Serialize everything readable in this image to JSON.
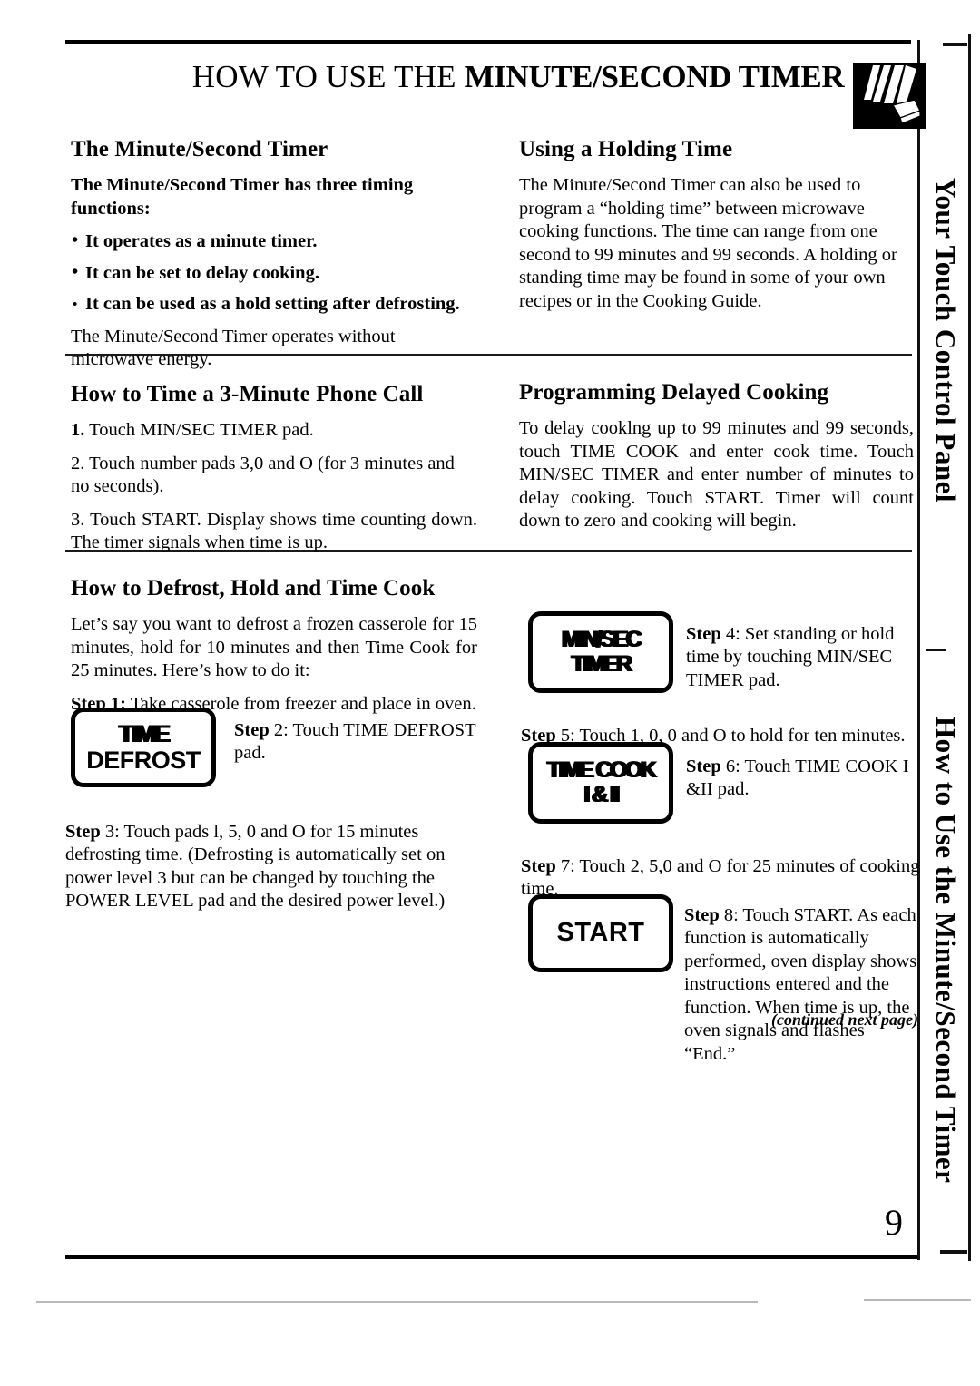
{
  "page": {
    "number": "9",
    "title_light": "HOW TO USE THE ",
    "title_bold": "MINUTE/SECOND TIMER",
    "header_icon": "hand-pressing-pad-icon",
    "continued_note": "(continued next page)"
  },
  "side_tabs": {
    "top": "Your Touch Control Panel",
    "bottom": "How to Use the Minute/Second Timer"
  },
  "sections": {
    "timer": {
      "heading": "The Minute/Second Timer",
      "intro": "The Minute/Second Timer has three timing functions:",
      "bullets": [
        "It operates as a minute timer.",
        "It can be set to delay cooking.",
        "It can be used as a hold setting after defrosting."
      ],
      "closing": "The Minute/Second Timer operates without microwave energy."
    },
    "holding": {
      "heading": "Using a Holding Time",
      "body": "The Minute/Second Timer can also be used to program a “holding time” between microwave cooking functions. The time can range from one second to 99 minutes and 99 seconds. A holding or standing time may be found in some of your own recipes or in the Cooking Guide."
    },
    "phone_call": {
      "heading": "How to Time a 3-Minute Phone Call",
      "steps": [
        {
          "num": "1.",
          "text": " Touch MIN/SEC TIMER pad."
        },
        {
          "num": "2.",
          "text": " Touch number pads 3,0 and O (for 3 minutes and no seconds)."
        },
        {
          "num": "3.",
          "text": " Touch START. Display shows time counting down. The timer signals when time is up."
        }
      ]
    },
    "delayed_cooking": {
      "heading": "Programming Delayed Cooking",
      "body": "To delay cooklng up to 99 minutes and 99 seconds, touch TIME COOK and enter cook time. Touch MIN/SEC TIMER and enter number of minutes to delay cooking. Touch START. Timer will count down to zero and cooking will begin."
    },
    "defrost_hold_cook": {
      "heading": "How to Defrost, Hold and Time Cook",
      "intro": "Let’s say you want to defrost a frozen casserole for 15 minutes, hold for 10 minutes and then Time Cook for 25 minutes. Here’s how to do it:",
      "steps": [
        {
          "num": "Step 1:",
          "text": " Take casserole from freezer and place in oven."
        },
        {
          "num": "Step",
          "text": " 2: Touch TIME DEFROST pad."
        },
        {
          "num": "Step",
          "text": " 3: Touch pads l, 5, 0 and O for 15 minutes defrosting time. (Defrosting is automatically set on power level 3 but can be changed by touching the POWER LEVEL pad and the desired power level.)"
        },
        {
          "num": "Step",
          "text": " 4: Set standing or hold time by touching MIN/SEC TIMER pad."
        },
        {
          "num": "Step",
          "text": " 5: Touch 1, 0, 0 and O to hold for ten minutes."
        },
        {
          "num": "Step",
          "text": " 6: Touch TIME COOK I &II pad."
        },
        {
          "num": "Step",
          "text": " 7: Touch 2, 5,0 and O for 25 minutes of cooking time."
        },
        {
          "num": "Step",
          "text": " 8: Touch START. As each function is automatically performed, oven display shows instructions entered and the function. When time is up, the oven signals and flashes “End.”"
        }
      ]
    }
  },
  "pads": {
    "time_defrost": {
      "line1": "TIME",
      "line2": "DEFROST"
    },
    "min_sec_timer": {
      "line1": "MIN/SEC",
      "line2": "TIMER"
    },
    "time_cook": {
      "line1": "TIME COOK",
      "line2": "I & II"
    },
    "start": {
      "line1": "START"
    }
  },
  "colors": {
    "ink": "#000000",
    "paper": "#ffffff",
    "artifact_gray": "#b9b9b9"
  }
}
